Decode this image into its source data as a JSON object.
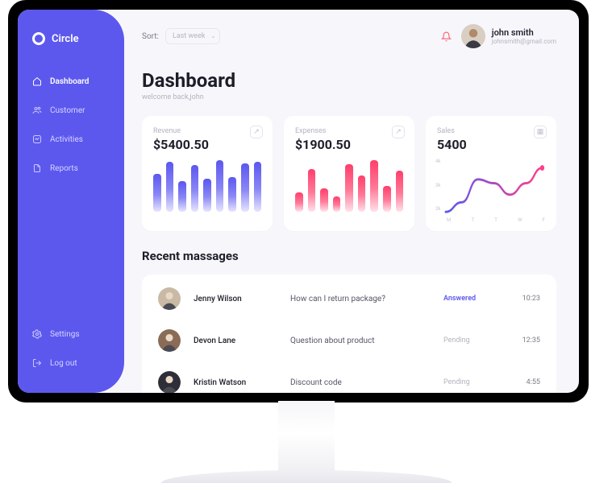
{
  "brand": {
    "name": "Circle"
  },
  "nav": {
    "primary": [
      {
        "label": "Dashboard",
        "icon": "home-icon",
        "active": true
      },
      {
        "label": "Customer",
        "icon": "users-icon",
        "active": false
      },
      {
        "label": "Activities",
        "icon": "activity-icon",
        "active": false
      },
      {
        "label": "Reports",
        "icon": "reports-icon",
        "active": false
      }
    ],
    "secondary": [
      {
        "label": "Settings",
        "icon": "settings-icon"
      },
      {
        "label": "Log out",
        "icon": "logout-icon"
      }
    ]
  },
  "topbar": {
    "sort_label": "Sort:",
    "sort_value": "Last week"
  },
  "user": {
    "name": "john smith",
    "email": "johnsmith@gmail.com"
  },
  "page": {
    "title": "Dashboard",
    "subtitle": "welcome back,john"
  },
  "cards": {
    "revenue": {
      "label": "Revenue",
      "value": "$5400.50"
    },
    "expenses": {
      "label": "Expenses",
      "value": "$1900.50"
    },
    "sales": {
      "label": "Sales",
      "value": "5400"
    }
  },
  "chart_data": [
    {
      "id": "revenue",
      "type": "bar",
      "title": "Revenue",
      "values": [
        44,
        58,
        36,
        54,
        38,
        60,
        40,
        56,
        58
      ]
    },
    {
      "id": "expenses",
      "type": "bar",
      "title": "Expenses",
      "values": [
        18,
        40,
        22,
        14,
        44,
        34,
        48,
        24,
        38
      ]
    },
    {
      "id": "sales",
      "type": "line",
      "title": "Sales",
      "x_labels": [
        "M",
        "T",
        "T",
        "W",
        "F"
      ],
      "y_ticks": [
        "4k",
        "3k",
        "2k"
      ],
      "ylim": [
        2000,
        4500
      ],
      "points": [
        2100,
        2600,
        3800,
        3600,
        3000,
        3600,
        4400
      ]
    }
  ],
  "messages": {
    "section_title": "Recent massages",
    "rows": [
      {
        "name": "Jenny Wilson",
        "subject": "How can I return package?",
        "status": "Answered",
        "status_key": "answered",
        "time": "10:23"
      },
      {
        "name": "Devon Lane",
        "subject": "Question about product",
        "status": "Pending",
        "status_key": "pending",
        "time": "12:35"
      },
      {
        "name": "Kristin Watson",
        "subject": "Discount code",
        "status": "Pending",
        "status_key": "pending",
        "time": "4:55"
      }
    ]
  },
  "colors": {
    "accent": "#5c58ee",
    "expense": "#ff3e6c",
    "grad_start": "#ff3e8a",
    "grad_end": "#5c58ee"
  }
}
